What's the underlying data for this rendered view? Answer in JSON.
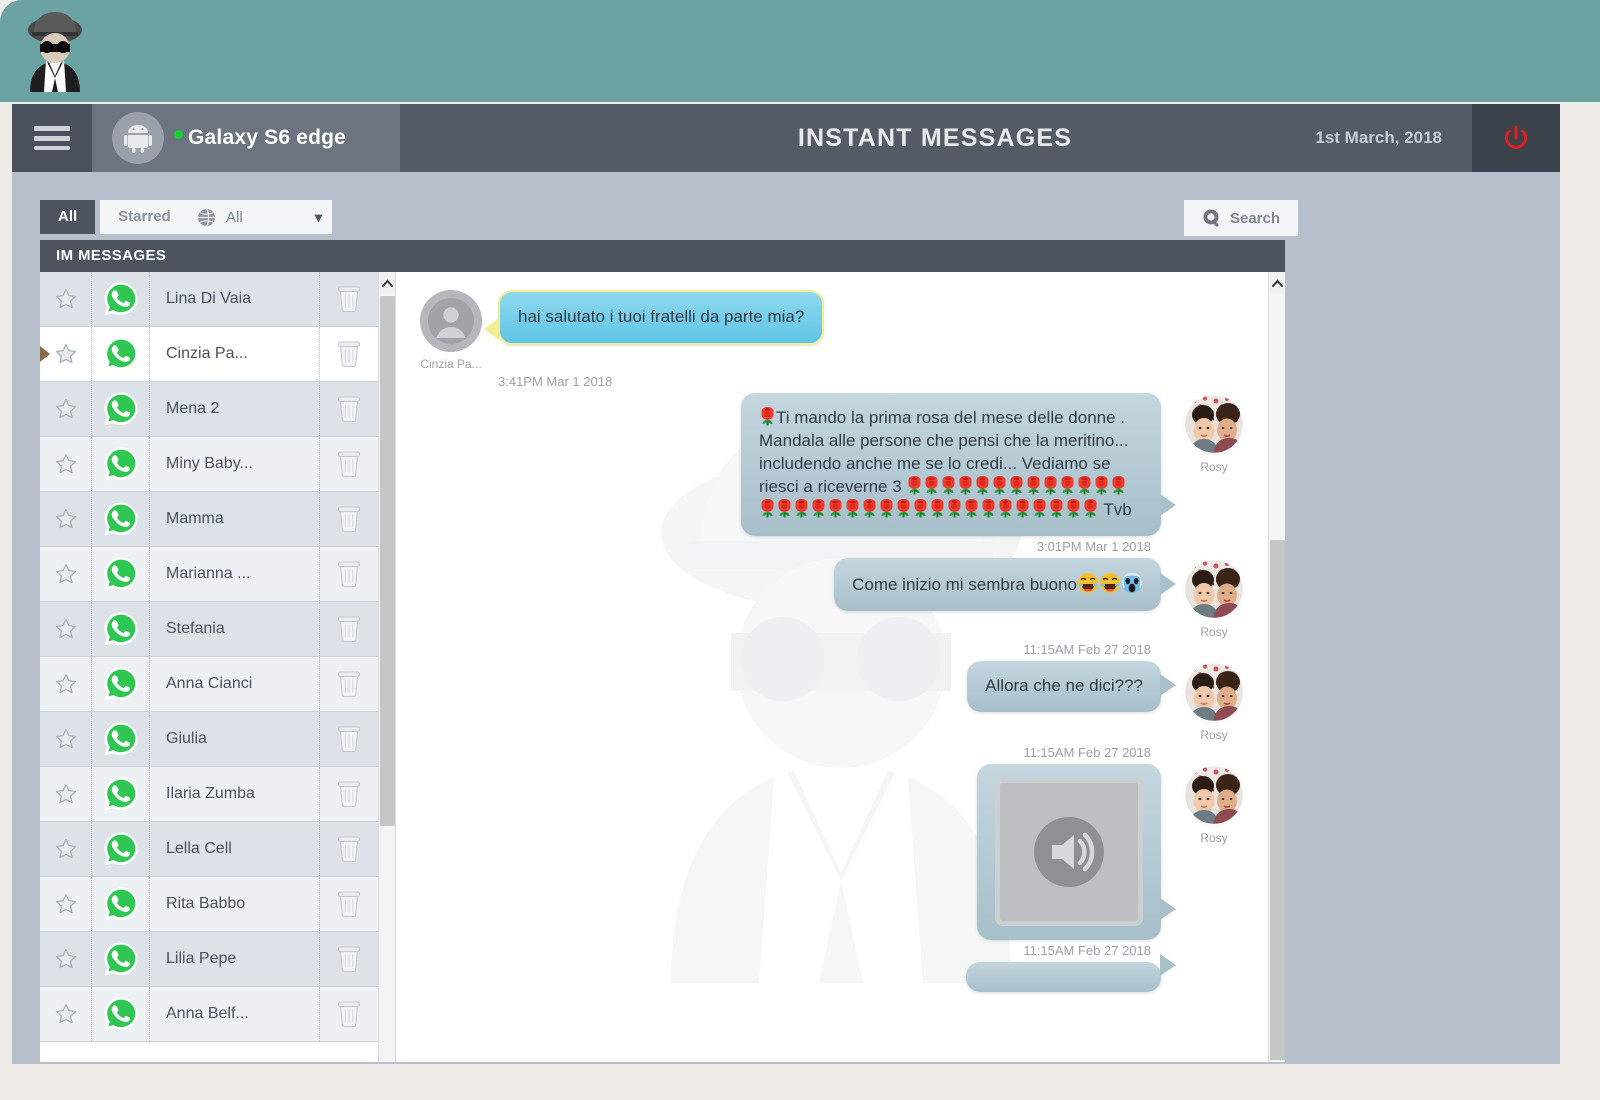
{
  "banner": {
    "logo_icon": "spy-logo-icon"
  },
  "topbar": {
    "menu_icon": "hamburger-menu-icon",
    "device_icon": "android-robot-icon",
    "device_status_icon": "online-status-dot-icon",
    "device_name": "Galaxy S6 edge",
    "title": "INSTANT MESSAGES",
    "date": "1st March, 2018",
    "power_icon": "power-icon"
  },
  "toolbar": {
    "tabs": [
      {
        "label": "All",
        "active": true
      },
      {
        "label": "Starred",
        "active": false
      }
    ],
    "protocol_filter": {
      "icon": "globe-icon",
      "value": "All",
      "caret_icon": "chevron-down-icon"
    },
    "search": {
      "icon": "search-icon",
      "label": "Search"
    }
  },
  "section": {
    "title": "IM MESSAGES"
  },
  "contacts": {
    "star_icon": "star-outline-icon",
    "app_icon": "whatsapp-icon",
    "delete_icon": "trash-can-icon",
    "scroll_up_icon": "chevron-up-icon",
    "items": [
      {
        "name": "Lina Di Vaia",
        "selected": false
      },
      {
        "name": "Cinzia Pa...",
        "selected": true
      },
      {
        "name": "Mena 2",
        "selected": false
      },
      {
        "name": "Miny Baby...",
        "selected": false
      },
      {
        "name": "Mamma",
        "selected": false
      },
      {
        "name": "Marianna ...",
        "selected": false
      },
      {
        "name": "Stefania",
        "selected": false
      },
      {
        "name": "Anna Cianci",
        "selected": false
      },
      {
        "name": "Giulia",
        "selected": false
      },
      {
        "name": "Ilaria Zumba",
        "selected": false
      },
      {
        "name": "Lella Cell",
        "selected": false
      },
      {
        "name": "Rita Babbo",
        "selected": false
      },
      {
        "name": "Lilia Pepe",
        "selected": false
      },
      {
        "name": "Anna Belf...",
        "selected": false
      }
    ]
  },
  "chat": {
    "scroll_up_icon": "chevron-up-icon",
    "watermark_icon": "spy-watermark-icon",
    "messages": [
      {
        "direction": "in",
        "sender": "Cinzia Pa...",
        "avatar_icon": "generic-contact-avatar-icon",
        "text": "hai salutato i tuoi fratelli da parte mia?",
        "timestamp": "3:41PM Mar 1 2018"
      },
      {
        "direction": "out",
        "sender": "Rosy",
        "avatar_icon": "rosy-photo-avatar-icon",
        "text": "Ti mando la prima rosa del mese delle donne . Mandala alle persone che pensi che la meritino... includendo anche me se lo credi... Vediamo se riesci a riceverne 3",
        "text_suffix": "Tvb",
        "leading_rose_count": 1,
        "rose_count": 33,
        "timestamp": "3:01PM Mar 1 2018"
      },
      {
        "direction": "out",
        "sender": "Rosy",
        "avatar_icon": "rosy-photo-avatar-icon",
        "text": "Come inizio mi sembra buono",
        "emojis": [
          "rolling-on-floor-laughing",
          "rolling-on-floor-laughing",
          "face-screaming-in-fear"
        ],
        "timestamp": "11:15AM Feb 27 2018"
      },
      {
        "direction": "out",
        "sender": "Rosy",
        "avatar_icon": "rosy-photo-avatar-icon",
        "text": "Allora che ne dici???",
        "timestamp": "11:15AM Feb 27 2018"
      },
      {
        "direction": "out",
        "sender": "Rosy",
        "avatar_icon": "rosy-photo-avatar-icon",
        "attachment_icon": "audio-speaker-icon",
        "timestamp": "11:15AM Feb 27 2018"
      }
    ]
  },
  "colors": {
    "banner": "#6aa3a1",
    "topbar": "#545b66",
    "page_bg": "#b7bfcc",
    "accent_power": "#e02020",
    "online": "#18cf33",
    "whatsapp": "#25d366",
    "bubble_in": "#5fc4e6",
    "bubble_in_border": "#f2ee92",
    "bubble_out": "#a7bfca"
  }
}
